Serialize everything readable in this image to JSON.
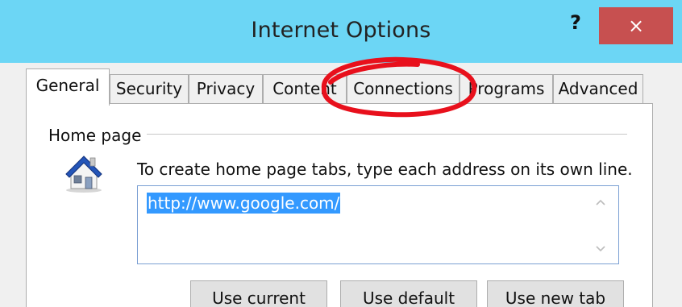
{
  "window": {
    "title": "Internet Options",
    "help_label": "?",
    "close_label": "×"
  },
  "tabs": [
    {
      "label": "General",
      "active": true
    },
    {
      "label": "Security"
    },
    {
      "label": "Privacy"
    },
    {
      "label": "Content"
    },
    {
      "label": "Connections"
    },
    {
      "label": "Programs"
    },
    {
      "label": "Advanced"
    }
  ],
  "home_page": {
    "group_label": "Home page",
    "instruction": "To create home page tabs, type each address on its own line.",
    "value": "http://www.google.com/"
  },
  "buttons": {
    "use_current": "Use current",
    "use_default": "Use default",
    "use_new_tab": "Use new tab"
  },
  "colors": {
    "titlebar": "#6cd6f5",
    "close": "#c75050",
    "selection": "#3399ff",
    "annotation": "#e8101c"
  },
  "icons": {
    "house": "house-icon",
    "annotation": "red-ellipse-annotation"
  }
}
